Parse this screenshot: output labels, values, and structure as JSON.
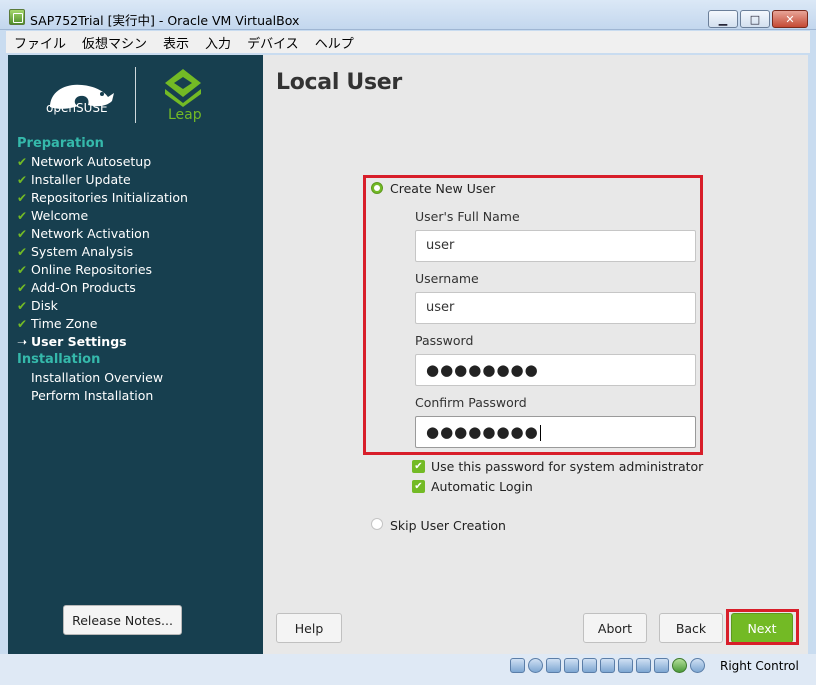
{
  "window": {
    "title": "SAP752Trial [実行中] - Oracle VM VirtualBox",
    "minimize_icon": "minimize-icon",
    "maximize_icon": "maximize-icon",
    "close_icon": "close-icon"
  },
  "menubar": {
    "items": [
      "ファイル",
      "仮想マシン",
      "表示",
      "入力",
      "デバイス",
      "ヘルプ"
    ]
  },
  "sidebar": {
    "logo_text": "openSUSE",
    "leap_text": "Leap",
    "sections": [
      {
        "title": "Preparation",
        "steps": [
          {
            "label": "Network Autosetup",
            "state": "done"
          },
          {
            "label": "Installer Update",
            "state": "done"
          },
          {
            "label": "Repositories Initialization",
            "state": "done"
          },
          {
            "label": "Welcome",
            "state": "done"
          },
          {
            "label": "Network Activation",
            "state": "done"
          },
          {
            "label": "System Analysis",
            "state": "done"
          },
          {
            "label": "Online Repositories",
            "state": "done"
          },
          {
            "label": "Add-On Products",
            "state": "done"
          },
          {
            "label": "Disk",
            "state": "done"
          },
          {
            "label": "Time Zone",
            "state": "done"
          },
          {
            "label": "User Settings",
            "state": "current"
          }
        ]
      },
      {
        "title": "Installation",
        "steps": [
          {
            "label": "Installation Overview",
            "state": "pending"
          },
          {
            "label": "Perform Installation",
            "state": "pending"
          }
        ]
      }
    ],
    "release_notes_label": "Release Notes..."
  },
  "main": {
    "title": "Local User",
    "create_new_user_label": "Create New User",
    "create_new_user_selected": true,
    "full_name_label": "User's Full Name",
    "full_name_value": "user",
    "username_label": "Username",
    "username_value": "user",
    "password_label": "Password",
    "password_value": "●●●●●●●●",
    "confirm_password_label": "Confirm Password",
    "confirm_password_value": "●●●●●●●●",
    "use_password_admin_label": "Use this password for system administrator",
    "use_password_admin_checked": true,
    "automatic_login_label": "Automatic Login",
    "automatic_login_checked": true,
    "skip_user_creation_label": "Skip User Creation",
    "skip_user_creation_selected": false
  },
  "buttons": {
    "help": "Help",
    "abort": "Abort",
    "back": "Back",
    "next": "Next"
  },
  "statusbar": {
    "icons": [
      "hard-disk-icon",
      "optical-drive-icon",
      "audio-icon",
      "network-icon",
      "usb-icon",
      "shared-folders-icon",
      "display-icon",
      "video-capture-icon",
      "recording-icon",
      "mouse-integration-icon",
      "arrow-down-icon"
    ],
    "host_key_label": "Right Control"
  },
  "colors": {
    "sidebar_bg": "#173f4f",
    "accent_green": "#73ba25",
    "section_teal": "#35b9ab",
    "highlight_red": "#d81e2a"
  }
}
